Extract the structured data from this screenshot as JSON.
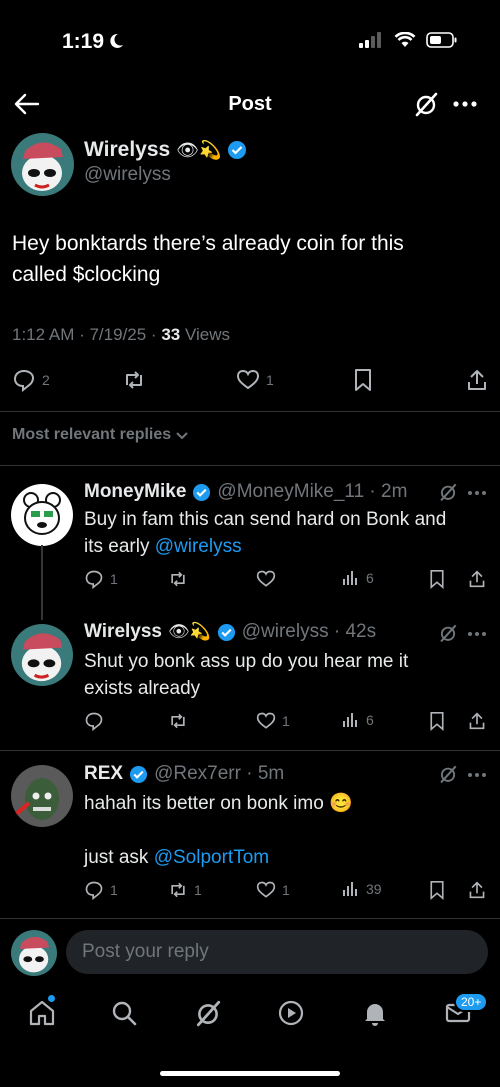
{
  "status_bar": {
    "time": "1:19"
  },
  "header": {
    "title": "Post"
  },
  "post": {
    "author_name": "Wirelyss",
    "author_emojis": "👁💫",
    "handle": "@wirelyss",
    "text_line1": "Hey bonktards there’s already coin for this",
    "text_line2": "called $clocking",
    "timestamp": "1:12 AM · 7/19/25 · ",
    "views_count": "33",
    "views_label": " Views",
    "replies_count": "2",
    "likes_count": "1"
  },
  "sort_label": "Most relevant replies",
  "replies": [
    {
      "name": "MoneyMike",
      "handle_time": "@MoneyMike_11 · 2m",
      "text_line1": "Buy in fam this can send hard on Bonk and",
      "text_line2_prefix": "its early ",
      "mention": "@wirelyss",
      "replies": "1",
      "retweets": "",
      "likes": "",
      "views": "6"
    },
    {
      "name": "Wirelyss",
      "emojis": "👁💫",
      "handle_time": "@wirelyss · 42s",
      "text_line1": "Shut yo bonk ass up do you hear me it",
      "text_line2": "exists already",
      "replies": "",
      "retweets": "",
      "likes": "1",
      "views": "6"
    },
    {
      "name": "REX",
      "handle_time": "@Rex7err · 5m",
      "text_line1": "hahah its better on bonk imo 😊",
      "text_line3_prefix": "just ask ",
      "mention": "@SolportTom",
      "replies": "1",
      "retweets": "1",
      "likes": "1",
      "views": "39"
    }
  ],
  "compose": {
    "placeholder": "Post your reply"
  },
  "tabbar": {
    "messages_badge": "20+"
  },
  "colors": {
    "accent": "#1d9bf0",
    "background": "#000000",
    "muted": "#71767b"
  }
}
